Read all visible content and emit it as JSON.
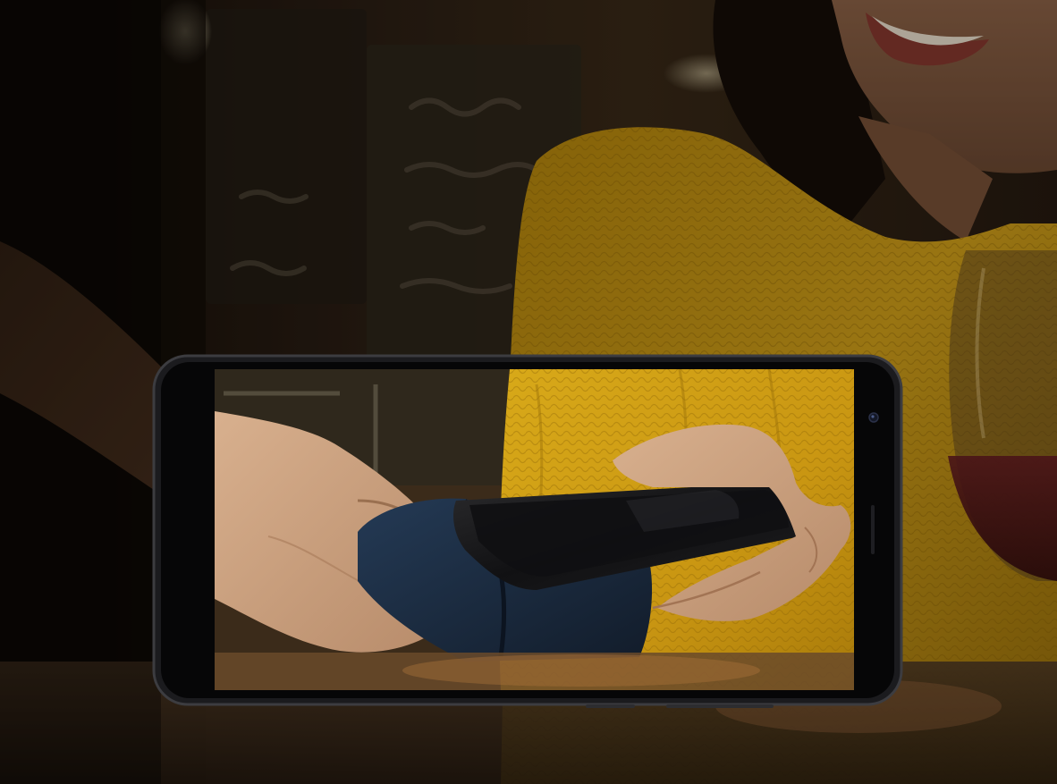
{
  "scene": {
    "subject": "contactless-payment-photo",
    "device": "smartphone-landscape-frame"
  },
  "colors": {
    "sweater": "#c99a12",
    "sweater_dark": "#8a6408",
    "background_wood": "#2a1c10",
    "chalkboard": "#2b2519",
    "phone_frame": "#1a1a1c",
    "phone_bezel": "#050506",
    "skin_light": "#c9a07e",
    "skin_dark": "#5b3a24",
    "hair": "#1a110b",
    "terminal": "#1c2a3d",
    "wine": "#3a0d10"
  }
}
